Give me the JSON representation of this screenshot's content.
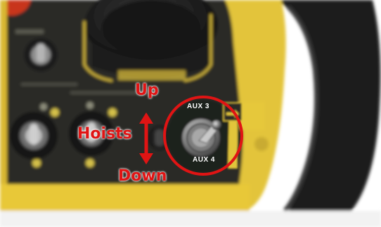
{
  "annotations": {
    "up": "Up",
    "hoists": "Hoists",
    "down": "Down"
  },
  "panel_labels": {
    "aux3": "AUX 3",
    "aux4": "AUX 4"
  },
  "colors": {
    "annotation": "#e01414",
    "panel": "#2a2b26",
    "housing_yellow": "#e8c838",
    "grip": "#1c1c1c"
  },
  "icons": {
    "direction_arrow": "double-headed-vertical-arrow",
    "highlight": "red-circle-outline"
  }
}
